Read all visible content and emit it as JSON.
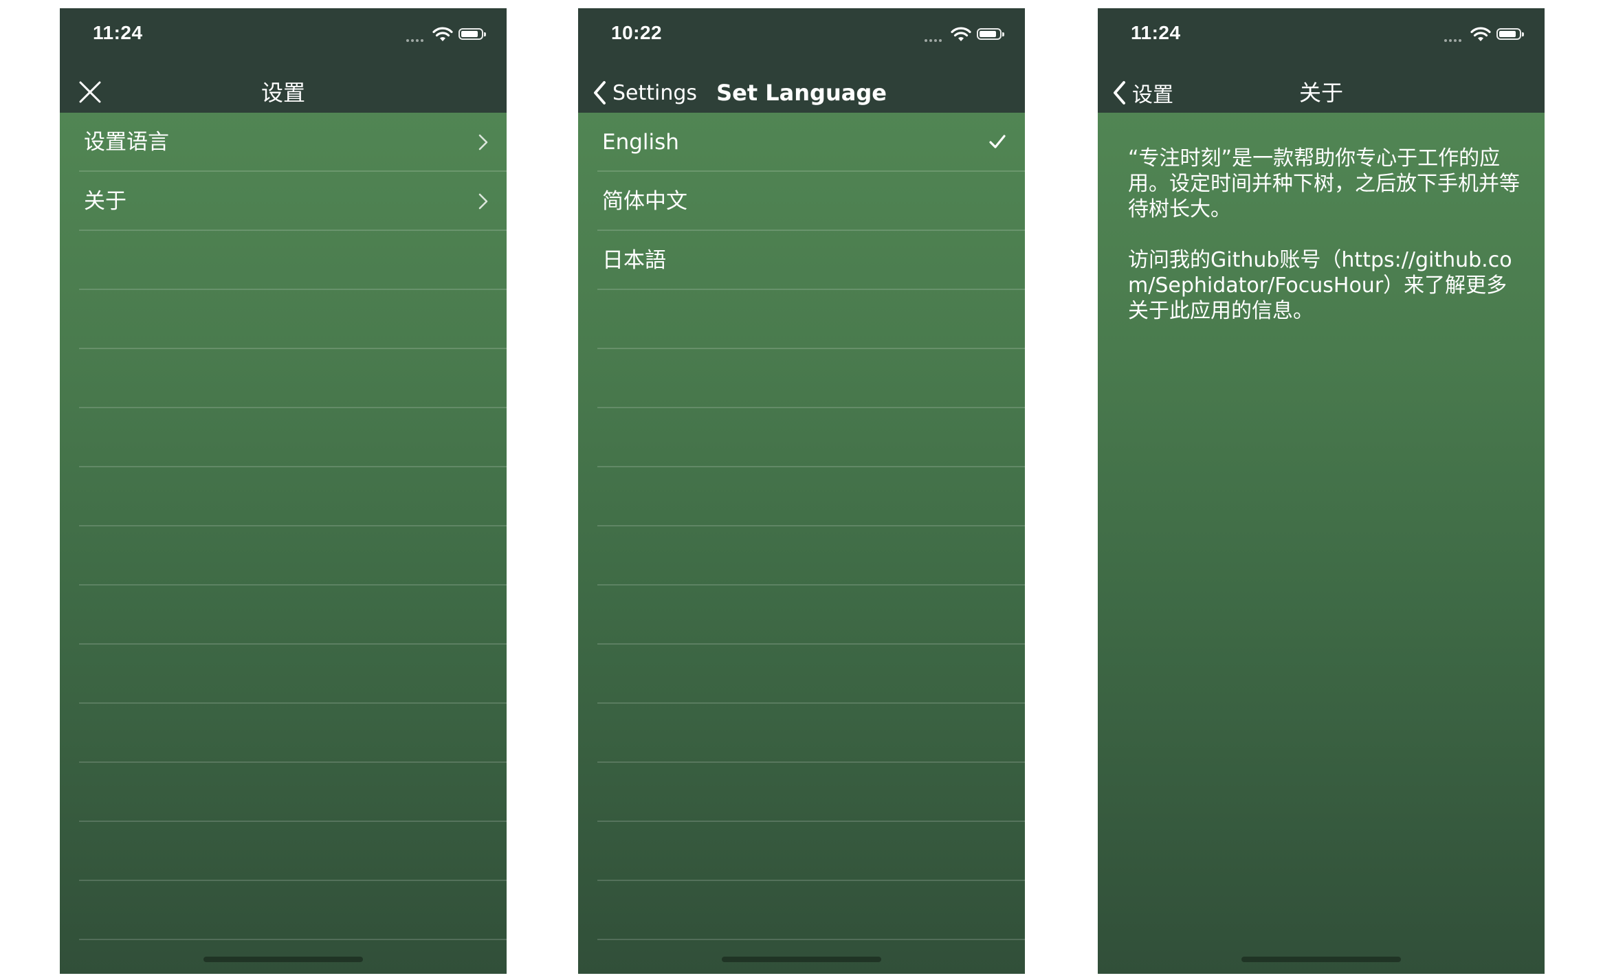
{
  "screens": [
    {
      "status_time": "11:24",
      "nav": {
        "title": "设置",
        "left_icon": "close-icon"
      },
      "rows": [
        {
          "label": "设置语言",
          "accessory": "chevron-right-icon"
        },
        {
          "label": "关于",
          "accessory": "chevron-right-icon"
        }
      ]
    },
    {
      "status_time": "10:22",
      "nav": {
        "title": "Set Language",
        "back_label": "Settings",
        "left_icon": "chevron-left-icon"
      },
      "rows": [
        {
          "label": "English",
          "accessory": "checkmark-icon",
          "selected": true
        },
        {
          "label": "简体中文"
        },
        {
          "label": "日本語"
        }
      ]
    },
    {
      "status_time": "11:24",
      "nav": {
        "title": "关于",
        "back_label": "设置",
        "left_icon": "chevron-left-icon"
      },
      "paragraphs": [
        "“专注时刻”是一款帮助你专心于工作的应用。设定时间并种下树，之后放下手机并等待树长大。",
        "访问我的Github账号（https://github.com/Sephidator/FocusHour）来了解更多关于此应用的信息。"
      ]
    }
  ],
  "colors": {
    "nav_bar": "#2e4038",
    "gradient_top": "#548a56",
    "gradient_bottom": "#314f39",
    "text": "#ffffff"
  }
}
